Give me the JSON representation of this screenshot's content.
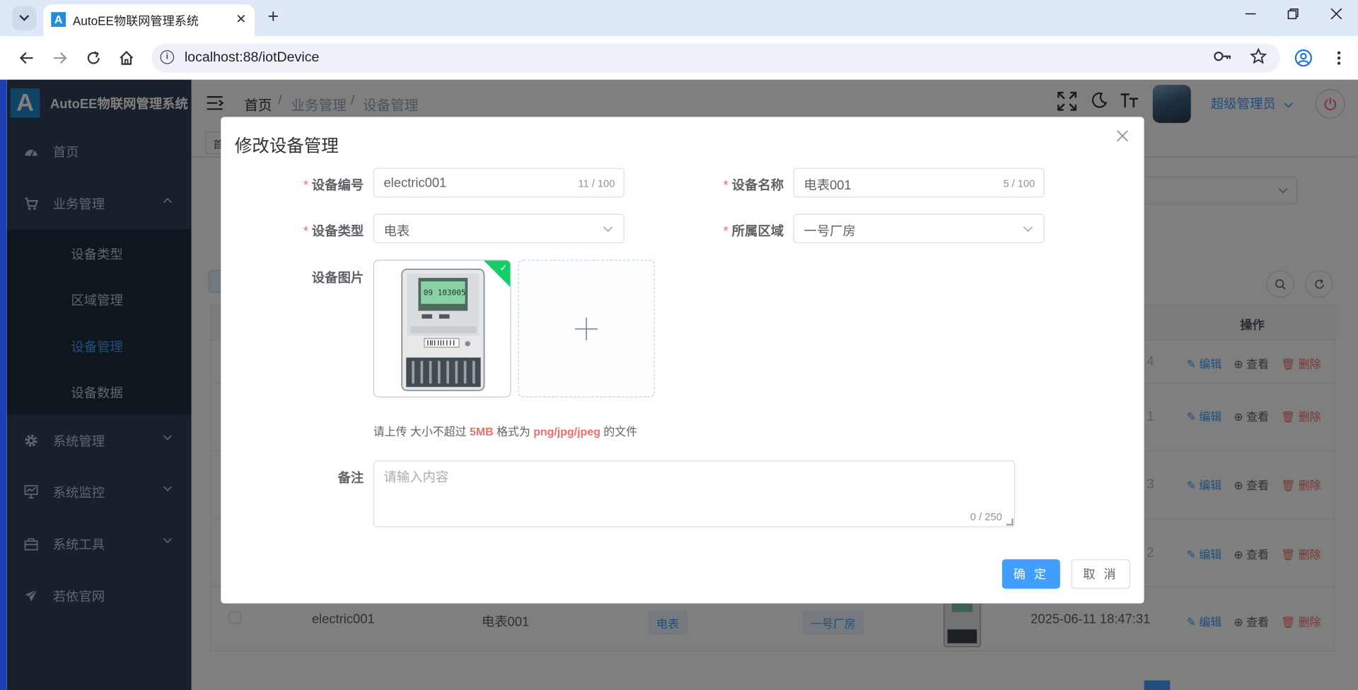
{
  "browser": {
    "tab_title": "AutoEE物联网管理系统",
    "tab_favicon": "A",
    "url": "localhost:88/iotDevice",
    "new_tab": "+",
    "close_tab": "✕"
  },
  "sidebar": {
    "logo_letter": "A",
    "title": "AutoEE物联网管理系统",
    "items": [
      {
        "label": "首页",
        "icon": "dashboard-icon"
      },
      {
        "label": "业务管理",
        "icon": "cart-icon"
      },
      {
        "label": "系统管理",
        "icon": "gear-icon"
      },
      {
        "label": "系统监控",
        "icon": "monitor-icon"
      },
      {
        "label": "系统工具",
        "icon": "toolbox-icon"
      },
      {
        "label": "若依官网",
        "icon": "send-icon"
      }
    ],
    "submenu": [
      {
        "label": "设备类型"
      },
      {
        "label": "区域管理"
      },
      {
        "label": "设备管理",
        "active": true
      },
      {
        "label": "设备数据"
      }
    ]
  },
  "header": {
    "breadcrumb": [
      "首页",
      "业务管理",
      "设备管理"
    ],
    "user_name": "超级管理员"
  },
  "tags_view": {
    "first": "首"
  },
  "table": {
    "op_header": "操作",
    "ops": {
      "edit": "编辑",
      "view": "查看",
      "delete": "删除"
    },
    "row_partial_digits": [
      "4",
      "1",
      "3",
      "2"
    ],
    "last_row": {
      "code": "electric001",
      "name": "电表001",
      "type": "电表",
      "area": "一号厂房",
      "time": "2025-06-11 18:47:31"
    }
  },
  "dialog": {
    "title": "修改设备管理",
    "code_label": "设备编号",
    "code_value": "electric001",
    "code_count": "11 / 100",
    "name_label": "设备名称",
    "name_value": "电表001",
    "name_count": "5 / 100",
    "type_label": "设备类型",
    "type_value": "电表",
    "area_label": "所属区域",
    "area_value": "一号厂房",
    "image_label": "设备图片",
    "tip_prefix": "请上传 大小不超过 ",
    "tip_size": "5MB",
    "tip_middle": " 格式为 ",
    "tip_formats": "png/jpg/jpeg",
    "tip_suffix": " 的文件",
    "remark_label": "备注",
    "remark_placeholder": "请输入内容",
    "remark_count": "0 / 250",
    "confirm": "确 定",
    "cancel": "取 消",
    "required_mark": "*",
    "meter_display": "09 103005"
  },
  "colors": {
    "primary": "#409eff",
    "danger": "#f56c6c",
    "sidebar_bg": "#304156",
    "success": "#13ce66"
  }
}
